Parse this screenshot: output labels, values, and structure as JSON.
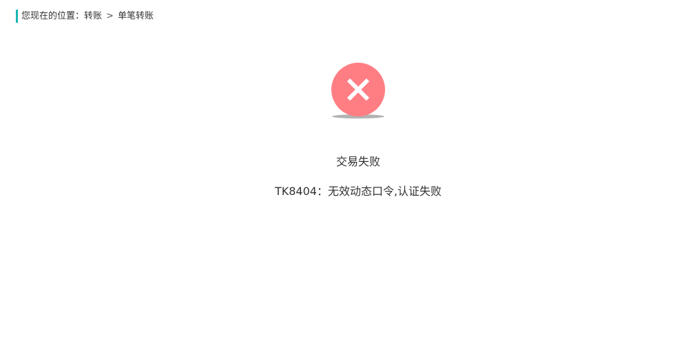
{
  "breadcrumb": {
    "prefix": "您现在的位置：",
    "items": [
      "转账",
      "单笔转账"
    ],
    "separator": ">"
  },
  "result": {
    "icon": "close-icon",
    "icon_color": "#ff7e83",
    "title": "交易失败",
    "message": "TK8404：无效动态口令,认证失败"
  },
  "colors": {
    "accent": "#19b6b3",
    "error": "#ff7e83"
  }
}
